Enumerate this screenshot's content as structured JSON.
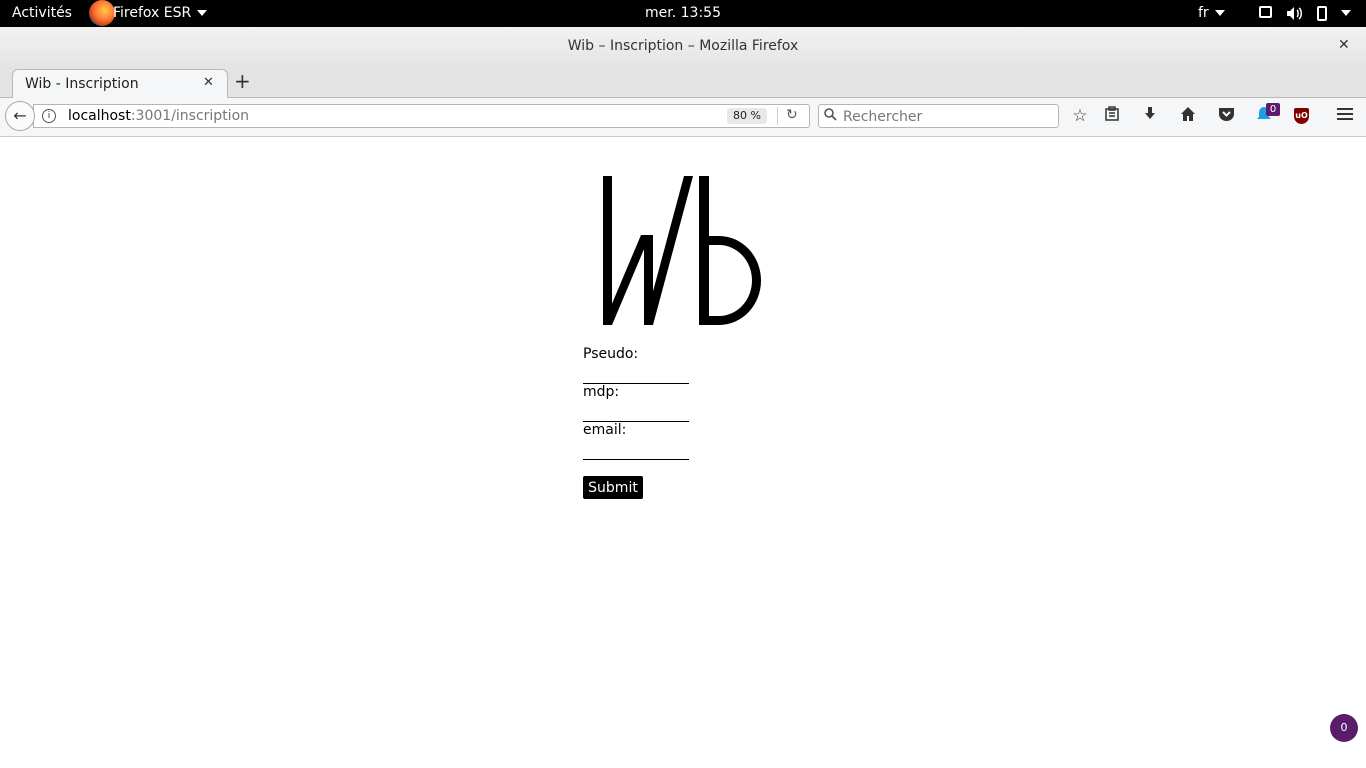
{
  "topbar": {
    "activities": "Activités",
    "app_name": "Firefox ESR",
    "clock": "mer. 13:55",
    "language": "fr"
  },
  "window": {
    "title": "Wib – Inscription – Mozilla Firefox"
  },
  "tabs": [
    {
      "label": "Wib - Inscription",
      "active": true
    }
  ],
  "navbar": {
    "url_host": "localhost",
    "url_path": ":3001/inscription",
    "zoom": "80 %",
    "search_placeholder": "Rechercher",
    "notification_count": "0"
  },
  "page": {
    "logo_text": "Wib",
    "form": {
      "pseudo_label": "Pseudo:",
      "mdp_label": "mdp:",
      "email_label": "email:",
      "submit_label": "Submit"
    },
    "counter": "0"
  },
  "icons": {
    "back": "arrow-left",
    "info": "info-circle",
    "reload": "reload",
    "search": "magnifier",
    "bookmark": "star",
    "library": "clipboard",
    "downloads": "arrow-down",
    "home": "home",
    "pocket": "pocket",
    "menu": "hamburger"
  }
}
